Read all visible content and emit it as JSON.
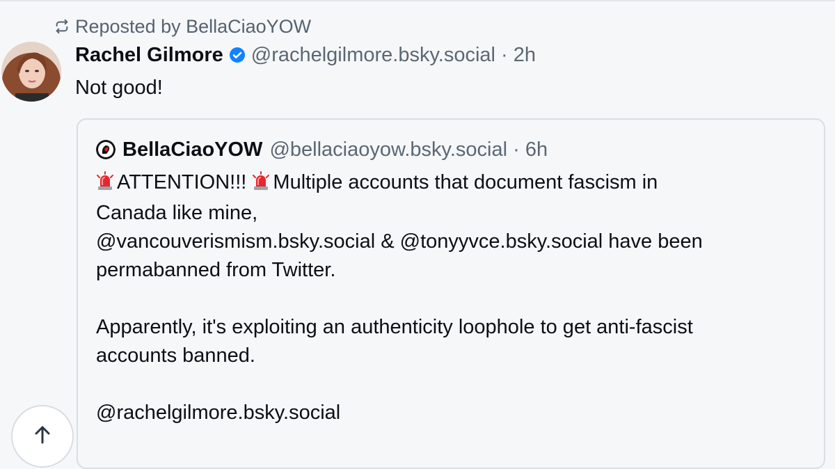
{
  "repost": {
    "icon": "repost-icon",
    "label": "Reposted by BellaCiaoYOW"
  },
  "post": {
    "author_name": "Rachel Gilmore",
    "verified_icon": "verified-badge-icon",
    "meta": "@rachelgilmore.bsky.social · 2h",
    "text": "Not good!"
  },
  "quote": {
    "author_name": "BellaCiaoYOW",
    "meta": "@bellaciaoyow.bsky.social · 6h",
    "line1_text": "ATTENTION!!!",
    "line1_rest": "Multiple accounts that document fascism in",
    "line2": "Canada like mine,",
    "line3": "@vancouverismism.bsky.social & @tonyyvce.bsky.social have been",
    "line4": "permabanned from Twitter.",
    "line5": "Apparently, it's exploiting an authenticity loophole to get anti-fascist",
    "line6": "accounts banned.",
    "line7": "@rachelgilmore.bsky.social",
    "emoji_icon": "police-siren-icon"
  },
  "scroll_button": {
    "icon": "arrow-up-icon"
  },
  "colors": {
    "background": "#f6f7f9",
    "muted": "#5b6773",
    "border": "#d9dee3",
    "verified": "#1083fe"
  }
}
